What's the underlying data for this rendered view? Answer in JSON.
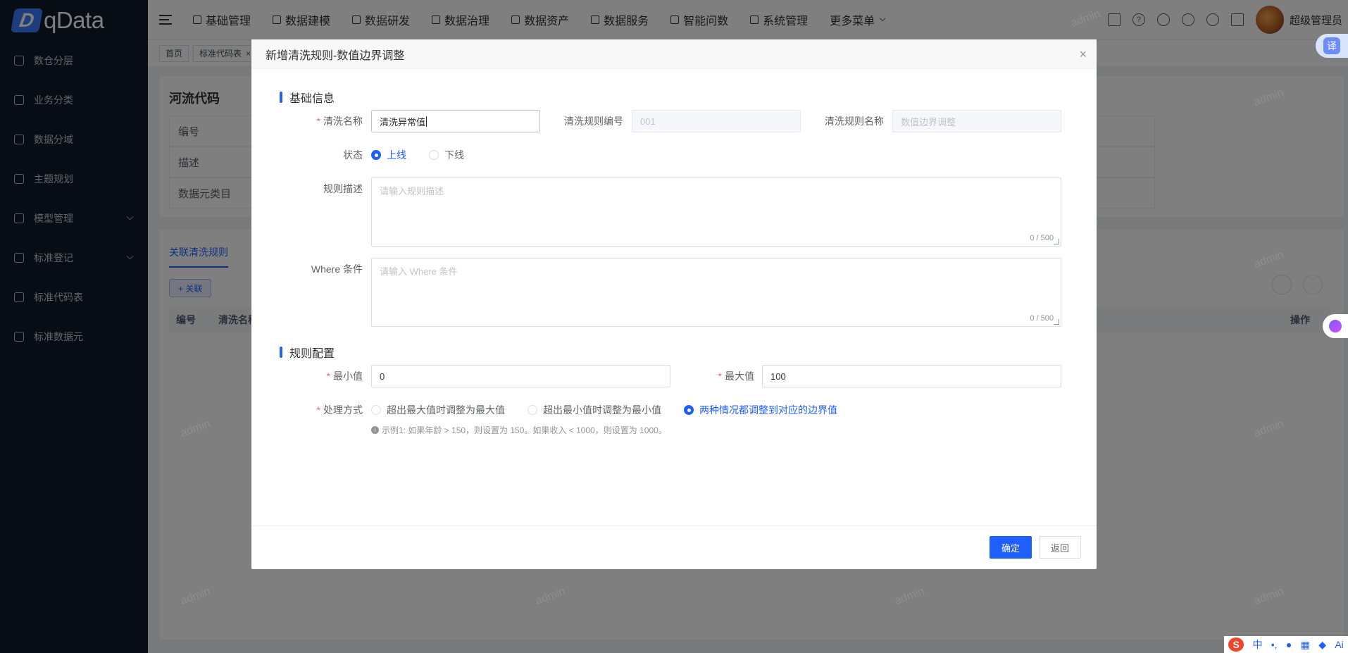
{
  "brand": {
    "logo_letter": "D",
    "name": "qData"
  },
  "sidebar": {
    "items": [
      {
        "label": "数仓分层",
        "has_children": false
      },
      {
        "label": "业务分类",
        "has_children": false
      },
      {
        "label": "数据分域",
        "has_children": false
      },
      {
        "label": "主题规划",
        "has_children": false
      },
      {
        "label": "模型管理",
        "has_children": true
      },
      {
        "label": "标准登记",
        "has_children": true
      },
      {
        "label": "标准代码表",
        "has_children": false
      },
      {
        "label": "标准数据元",
        "has_children": false
      }
    ]
  },
  "topnav": {
    "items": [
      "基础管理",
      "数据建模",
      "数据研发",
      "数据治理",
      "数据资产",
      "数据服务",
      "智能问数",
      "系统管理"
    ],
    "more": "更多菜单"
  },
  "header": {
    "notification_count": "",
    "username": "超级管理员",
    "translate_label": "译"
  },
  "tags": [
    {
      "label": "首页"
    },
    {
      "label": "标准代码表"
    }
  ],
  "background": {
    "title": "河流代码",
    "rows": [
      "编号",
      "描述",
      "数据元类目"
    ],
    "tab": "关联清洗规则",
    "add_button": "+ 关联",
    "table_headers": [
      "编号",
      "清洗名称"
    ],
    "table_op": "操作",
    "watermark": "admin"
  },
  "dialog": {
    "title": "新增清洗规则-数值边界调整",
    "section_basic": "基础信息",
    "section_config": "规则配置",
    "fields": {
      "clean_name": {
        "label": "清洗名称",
        "value": "清洗异常值"
      },
      "rule_code": {
        "label": "清洗规则编号",
        "value": "001"
      },
      "rule_name": {
        "label": "清洗规则名称",
        "value": "数值边界调整"
      },
      "status": {
        "label": "状态",
        "options": [
          "上线",
          "下线"
        ],
        "selected": "上线"
      },
      "description": {
        "label": "规则描述",
        "placeholder": "请输入规则描述",
        "counter": "0 / 500"
      },
      "where": {
        "label": "Where 条件",
        "placeholder": "请输入 Where 条件",
        "counter": "0 / 500"
      },
      "min": {
        "label": "最小值",
        "value": "0"
      },
      "max": {
        "label": "最大值",
        "value": "100"
      },
      "mode": {
        "label": "处理方式",
        "options": [
          "超出最大值时调整为最大值",
          "超出最小值时调整为最小值",
          "两种情况都调整到对应的边界值"
        ],
        "selected": "两种情况都调整到对应的边界值"
      },
      "hint": "示例1: 如果年龄 > 150，则设置为 150。如果收入 < 1000，则设置为 1000。"
    },
    "required_mark": "*",
    "confirm": "确定",
    "back": "返回",
    "close": "×"
  },
  "ime": {
    "logo": "S",
    "lang": "中",
    "ai": "Ai"
  }
}
